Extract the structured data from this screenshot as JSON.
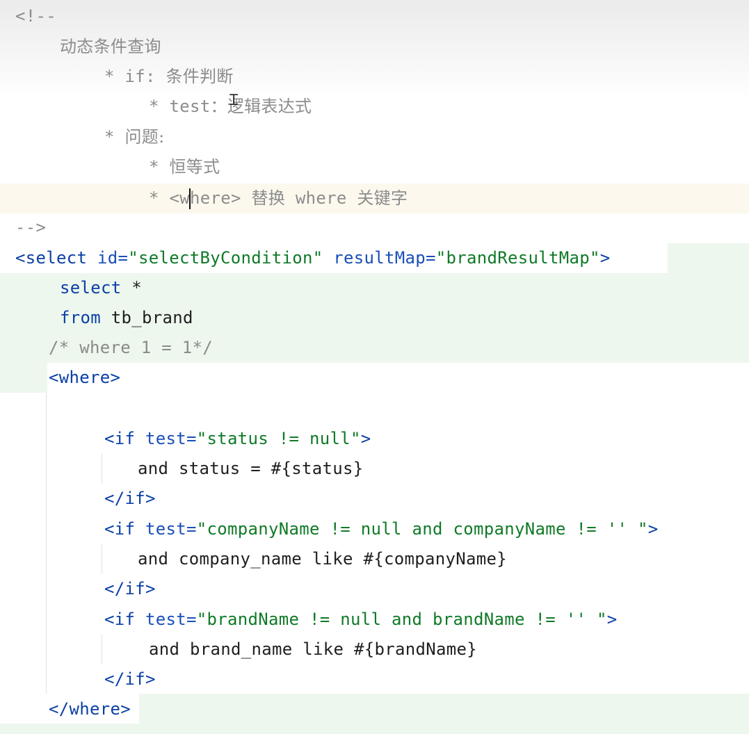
{
  "editor": {
    "lines": [
      [
        {
          "c": "cm",
          "t": "<!--"
        }
      ],
      [
        {
          "c": "cj",
          "t": "动态条件查询"
        }
      ],
      [
        {
          "c": "cm",
          "t": "* if: "
        },
        {
          "c": "cj",
          "t": "条件判断"
        }
      ],
      [
        {
          "c": "cm",
          "t": "* test："
        },
        {
          "c": "cj",
          "t": "逻辑表达式"
        }
      ],
      [
        {
          "c": "cm",
          "t": "* "
        },
        {
          "c": "cj",
          "t": "问题:"
        }
      ],
      [
        {
          "c": "cm",
          "t": "* "
        },
        {
          "c": "cj",
          "t": "恒等式"
        }
      ],
      [
        {
          "c": "cm",
          "t": "* <w"
        },
        {
          "c": "caret",
          "t": ""
        },
        {
          "c": "cm",
          "t": "here> "
        },
        {
          "c": "cj",
          "t": "替换"
        },
        {
          "c": "cm",
          "t": " where "
        },
        {
          "c": "cj",
          "t": "关键字"
        }
      ],
      [
        {
          "c": "cm",
          "t": "-->"
        }
      ],
      [
        {
          "c": "tg",
          "t": "<select "
        },
        {
          "c": "at",
          "t": "id="
        },
        {
          "c": "st",
          "t": "\"selectByCondition\" "
        },
        {
          "c": "at",
          "t": "resultMap="
        },
        {
          "c": "st",
          "t": "\"brandResultMap\""
        },
        {
          "c": "tg",
          "t": ">"
        }
      ],
      [
        {
          "c": "kw",
          "t": "select "
        },
        {
          "c": "tx",
          "t": "*"
        }
      ],
      [
        {
          "c": "kw",
          "t": "from "
        },
        {
          "c": "tx",
          "t": "tb_brand"
        }
      ],
      [
        {
          "c": "cmb",
          "t": "/* where 1 = 1*/"
        }
      ],
      [
        {
          "c": "tg",
          "t": "<where>"
        }
      ],
      [],
      [
        {
          "c": "tg",
          "t": "<if "
        },
        {
          "c": "at",
          "t": "test="
        },
        {
          "c": "st",
          "t": "\"status != null\""
        },
        {
          "c": "tg",
          "t": ">"
        }
      ],
      [
        {
          "c": "tx",
          "t": "and status = #{status}"
        }
      ],
      [
        {
          "c": "tg",
          "t": "</if>"
        }
      ],
      [
        {
          "c": "tg",
          "t": "<if "
        },
        {
          "c": "at",
          "t": "test="
        },
        {
          "c": "st",
          "t": "\"companyName != null and companyName != '' \""
        },
        {
          "c": "tg",
          "t": ">"
        }
      ],
      [
        {
          "c": "tx",
          "t": "and company_name like #{companyName}"
        }
      ],
      [
        {
          "c": "tg",
          "t": "</if>"
        }
      ],
      [
        {
          "c": "tg",
          "t": "<if "
        },
        {
          "c": "at",
          "t": "test="
        },
        {
          "c": "st",
          "t": "\"brandName != null and brandName != '' \""
        },
        {
          "c": "tg",
          "t": ">"
        }
      ],
      [
        {
          "c": "tx",
          "t": "and brand_name like #{brandName}"
        }
      ],
      [
        {
          "c": "tg",
          "t": "</if>"
        }
      ],
      [
        {
          "c": "tg",
          "t": "</where>"
        }
      ]
    ]
  },
  "colors": {
    "comment": "#8c8c8c",
    "tag": "#0a3fa6",
    "attribute": "#1a4fb8",
    "string": "#107a28",
    "text": "#1f1f1f",
    "current_line": "#fcf8ee",
    "sql_region": "#edf7ee"
  },
  "icons": {
    "mouse_cursor": "text-cursor-icon"
  }
}
